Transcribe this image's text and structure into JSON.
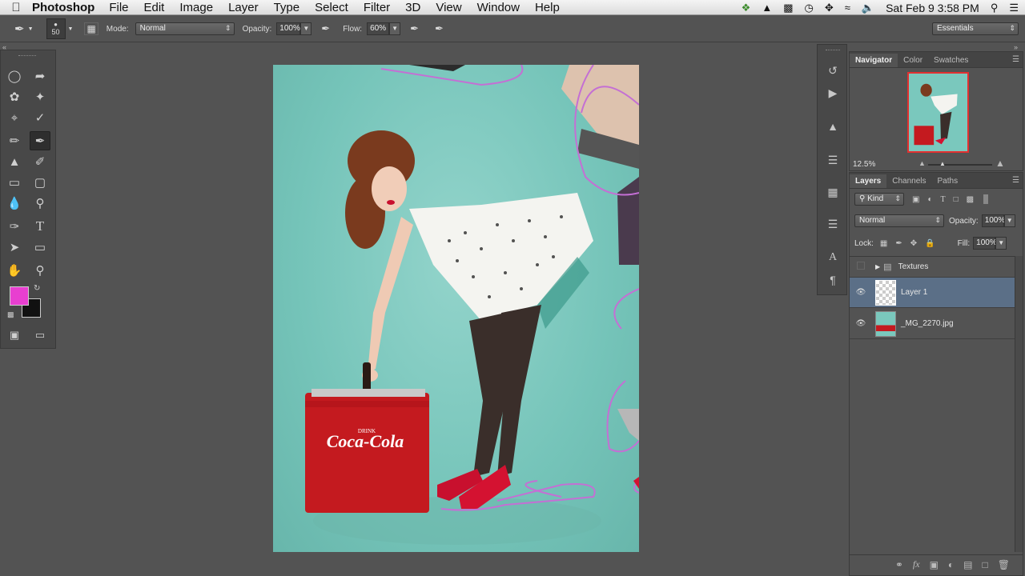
{
  "menubar": {
    "app_name": "Photoshop",
    "items": [
      "File",
      "Edit",
      "Image",
      "Layer",
      "Type",
      "Select",
      "Filter",
      "3D",
      "View",
      "Window",
      "Help"
    ],
    "clock": "Sat Feb 9  3:58 PM"
  },
  "options": {
    "brush_size": "50",
    "mode_label": "Mode:",
    "mode_value": "Normal",
    "opacity_label": "Opacity:",
    "opacity_value": "100%",
    "flow_label": "Flow:",
    "flow_value": "60%",
    "workspace": "Essentials"
  },
  "colors": {
    "foreground": "#e83fd0",
    "background": "#111111",
    "canvas_bg": "#7ac8bd"
  },
  "document": {
    "cooler_brand": "Coca-Cola",
    "cooler_top_text": "DRINK"
  },
  "navigator": {
    "tabs": [
      "Navigator",
      "Color",
      "Swatches"
    ],
    "zoom": "12.5%"
  },
  "layers_panel": {
    "tabs": [
      "Layers",
      "Channels",
      "Paths"
    ],
    "filter_kind": "Kind",
    "blend_mode": "Normal",
    "opacity_label": "Opacity:",
    "opacity_value": "100%",
    "lock_label": "Lock:",
    "fill_label": "Fill:",
    "fill_value": "100%",
    "layers": [
      {
        "name": "Textures",
        "type": "group"
      },
      {
        "name": "Layer 1",
        "type": "layer",
        "selected": true
      },
      {
        "name": "_MG_2270.jpg",
        "type": "image"
      }
    ]
  }
}
